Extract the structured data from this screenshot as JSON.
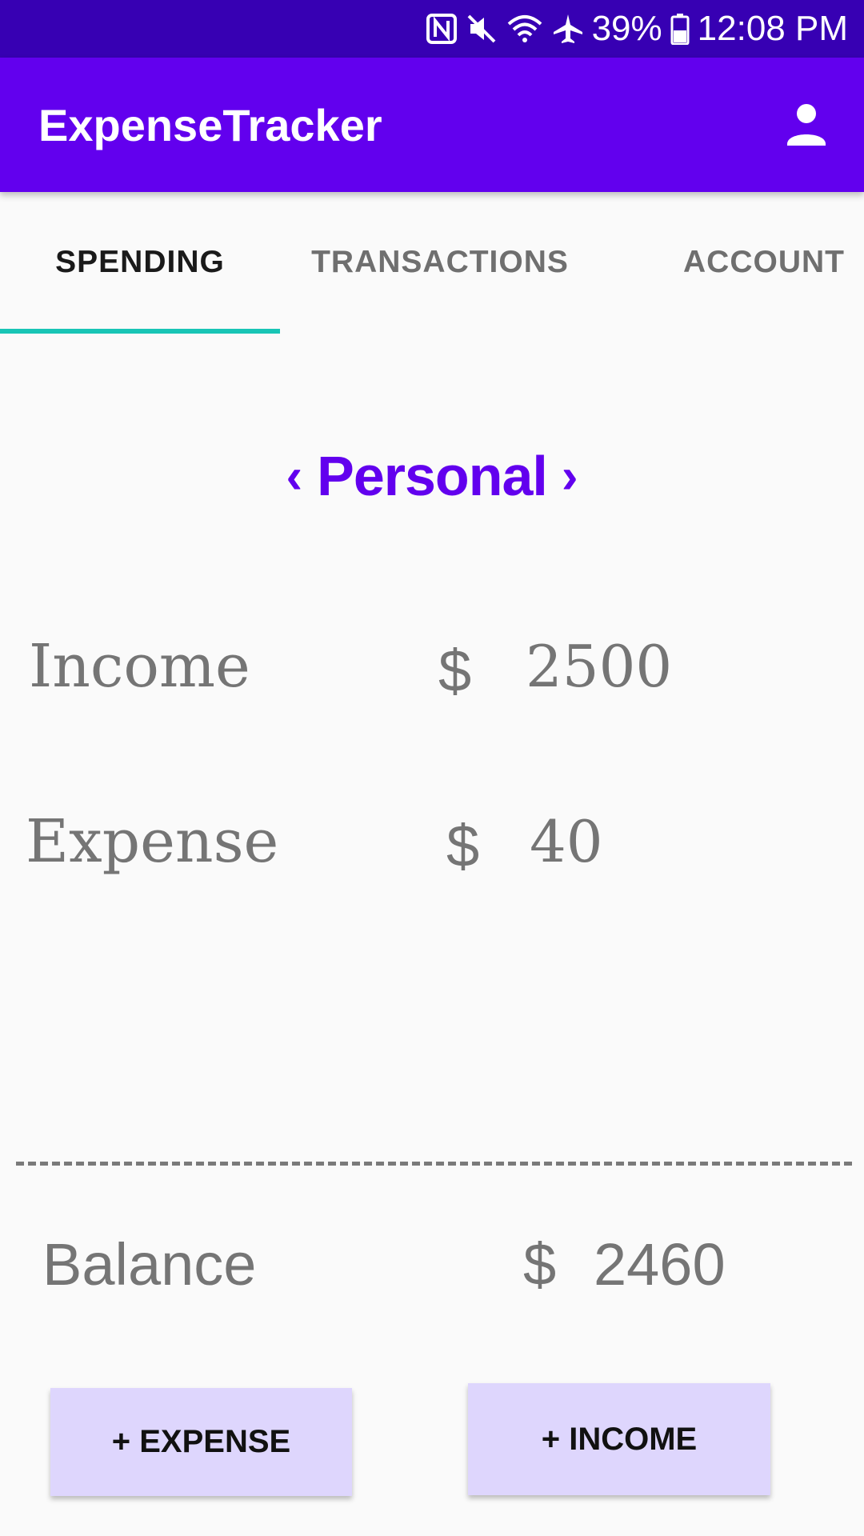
{
  "status_bar": {
    "battery": "39%",
    "time": "12:08 PM",
    "icons": [
      "nfc-icon",
      "mute-icon",
      "wifi-icon",
      "airplane-icon",
      "battery-icon"
    ]
  },
  "app_bar": {
    "title": "ExpenseTracker",
    "account_icon": "account-icon"
  },
  "tabs": [
    {
      "label": "SPENDING",
      "selected": true
    },
    {
      "label": "TRANSACTIONS",
      "selected": false
    },
    {
      "label": "ACCOUNT",
      "selected": false
    }
  ],
  "wallet": {
    "prev": "‹",
    "name": "Personal",
    "next": "›"
  },
  "summary": {
    "income_label": "Income",
    "income_currency": "$",
    "income_value": "2500",
    "expense_label": "Expense",
    "expense_currency": "$",
    "expense_value": "40",
    "balance_label": "Balance",
    "balance_currency": "$",
    "balance_value": "2460"
  },
  "buttons": {
    "add_expense": "+ EXPENSE",
    "add_income": "+ INCOME"
  },
  "colors": {
    "status_bar": "#3700b3",
    "primary": "#6200ee",
    "tab_indicator": "#18c5b5",
    "button_bg": "#ded6fd",
    "text_gray": "#757575"
  }
}
